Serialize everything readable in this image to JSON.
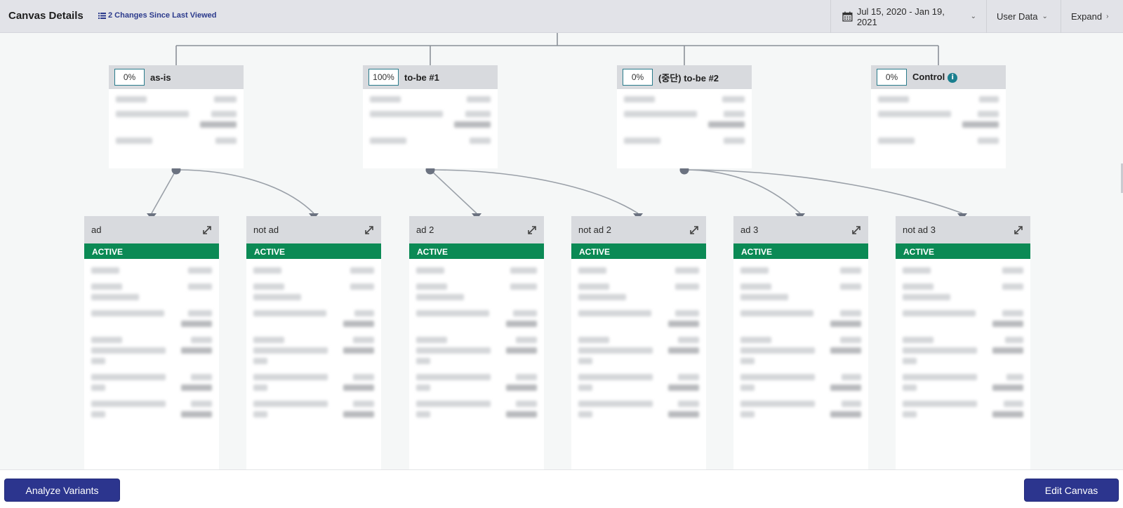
{
  "header": {
    "title": "Canvas Details",
    "changes_label": "2 Changes Since Last Viewed",
    "date_range": "Jul 15, 2020 - Jan 19, 2021",
    "user_data": "User Data",
    "expand": "Expand"
  },
  "variants": [
    {
      "percent": "0%",
      "name": "as-is"
    },
    {
      "percent": "100%",
      "name": "to-be #1"
    },
    {
      "percent": "0%",
      "name": "(중단) to-be #2"
    },
    {
      "percent": "0%",
      "name": "Control"
    }
  ],
  "steps": [
    {
      "name": "ad",
      "status": "ACTIVE"
    },
    {
      "name": "not ad",
      "status": "ACTIVE"
    },
    {
      "name": "ad 2",
      "status": "ACTIVE"
    },
    {
      "name": "not ad 2",
      "status": "ACTIVE"
    },
    {
      "name": "ad 3",
      "status": "ACTIVE"
    },
    {
      "name": "not ad 3",
      "status": "ACTIVE"
    }
  ],
  "footer": {
    "analyze_label": "Analyze Variants",
    "edit_label": "Edit Canvas"
  },
  "colors": {
    "accent": "#2c358e",
    "active": "#0b8a55",
    "percent_border": "#2a7c8c",
    "connector": "#8a9098"
  },
  "icons": [
    "calendar-icon",
    "list-icon",
    "chevron-down-icon",
    "chevron-right-icon",
    "info-icon",
    "expand-arrows-icon"
  ]
}
